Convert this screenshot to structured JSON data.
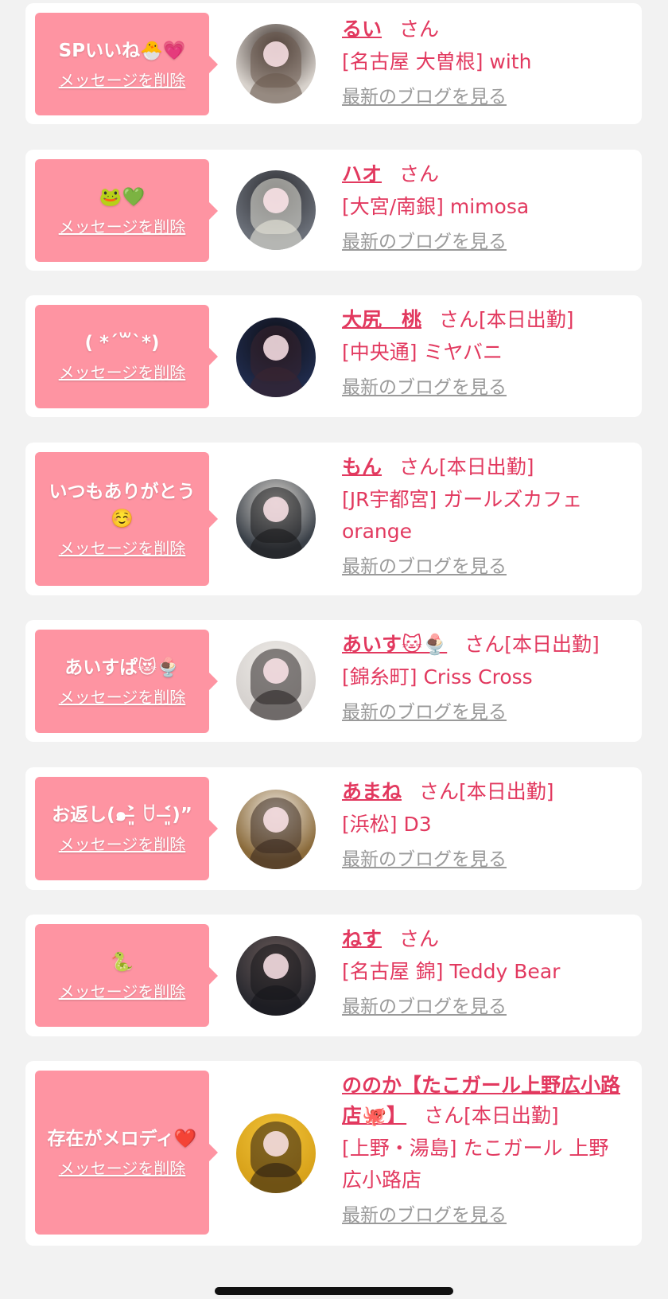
{
  "delete_label": "メッセージを削除",
  "blog_label": "最新のブログを見る",
  "san_label": "さん",
  "items": [
    {
      "message": "SPいいね🐣💗",
      "name": "るい",
      "status": "",
      "shop": "[名古屋 大曽根] with",
      "avatar_colors": [
        "#d8d2cc",
        "#6b5a4e",
        "#3a2f2a"
      ]
    },
    {
      "message": "🐸💚",
      "name": "ハオ",
      "status": "",
      "shop": "[大宮/南銀] mimosa",
      "avatar_colors": [
        "#6a6f78",
        "#e8e6da",
        "#2a2a2e"
      ]
    },
    {
      "message": "( *´꒳`*)",
      "name": "大尻　桃",
      "status": "[本日出勤]",
      "shop": "[中央通] ミヤバニ",
      "avatar_colors": [
        "#1f2a4a",
        "#3a2530",
        "#0e0e14"
      ]
    },
    {
      "message": "いつもありがとう☺️",
      "name": "もん",
      "status": "[本日出勤]",
      "shop": "[JR宇都宮] ガールズカフェ orange",
      "avatar_colors": [
        "#3a4048",
        "#1a1a1c",
        "#e0dcd6"
      ]
    },
    {
      "message": "あいすぱ😻🍨",
      "name": "あいす🐱🍨",
      "status": "[本日出勤]",
      "shop": "[錦糸町] Criss Cross",
      "avatar_colors": [
        "#d6d2cf",
        "#2a2424",
        "#efece8"
      ]
    },
    {
      "message": "お返し(๑˃̶͈̀ ꇴ ˂̶͈́)”",
      "name": "あまね",
      "status": "[本日出勤]",
      "shop": "[浜松] D3",
      "avatar_colors": [
        "#8a6a3a",
        "#3a2a20",
        "#f4eee6"
      ]
    },
    {
      "message": "🐍",
      "name": "ねす",
      "status": "",
      "shop": "[名古屋 錦] Teddy Bear",
      "avatar_colors": [
        "#2a2a30",
        "#15151a",
        "#6a5a58"
      ]
    },
    {
      "message": "存在がメロディ❤️",
      "name": "ののか【たこガール上野広小路店🐙】",
      "status": "[本日出勤]",
      "shop": "[上野・湯島] たこガール 上野広小路店",
      "avatar_colors": [
        "#d8a21a",
        "#2a1c10",
        "#f2c43a"
      ]
    }
  ]
}
